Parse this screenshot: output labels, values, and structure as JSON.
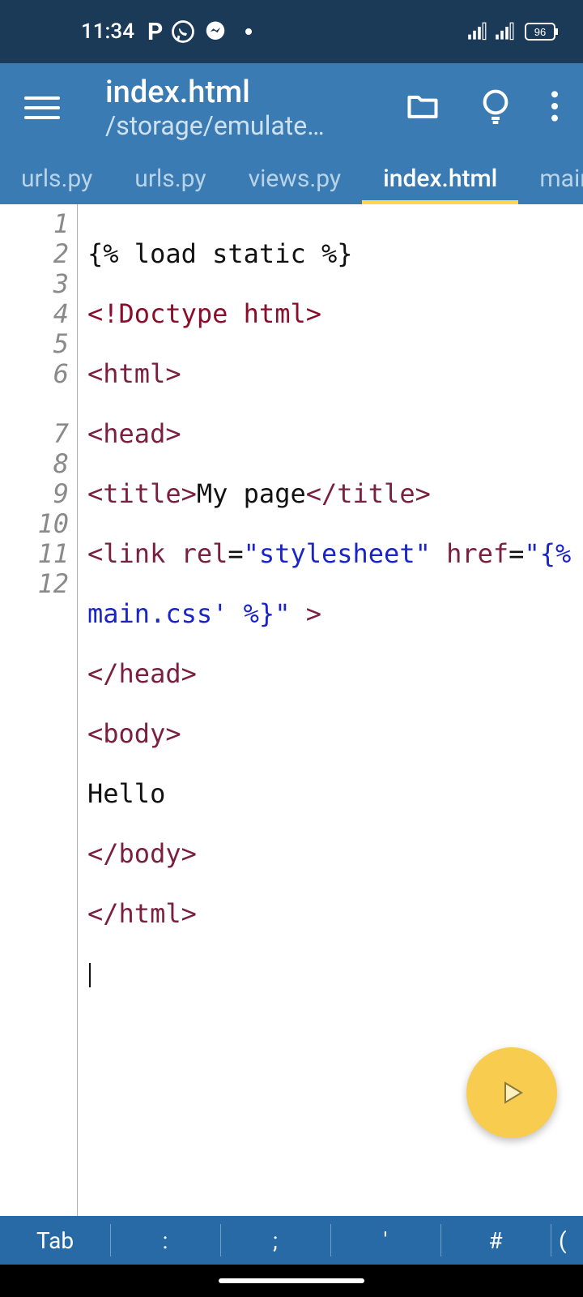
{
  "status": {
    "time": "11:34",
    "battery": "96"
  },
  "header": {
    "title": "index.html",
    "path": "/storage/emulate…"
  },
  "tabs": [
    {
      "label": "urls.py",
      "active": false
    },
    {
      "label": "urls.py",
      "active": false
    },
    {
      "label": "views.py",
      "active": false
    },
    {
      "label": "index.html",
      "active": true
    },
    {
      "label": "main.css",
      "active": false
    }
  ],
  "gutter": [
    "1",
    "2",
    "3",
    "4",
    "5",
    "6",
    "",
    "7",
    "8",
    "9",
    "10",
    "11",
    "12"
  ],
  "code": {
    "l1": "{% load static %}",
    "l2a": "<!Doctype html",
    "l3a": "<",
    "l3b": "html",
    "l3c": ">",
    "l4a": "<",
    "l4b": "head",
    "l4c": ">",
    "l5a": "<",
    "l5b": "title",
    "l5c": ">",
    "l5d": "My page",
    "l5e": "</",
    "l5f": "title",
    "l5g": ">",
    "l6a": "<",
    "l6b": "link",
    "l6sp": " ",
    "l6c": "rel",
    "l6d": "=",
    "l6e": "\"stylesheet\"",
    "l6sp2": " ",
    "l6f": "href",
    "l6g": "=",
    "l6h": "\"{% static 'todo/",
    "l6i": "main.css' %}\"",
    "l6j": " >",
    "l7a": "</",
    "l7b": "head",
    "l7c": ">",
    "l8a": "<",
    "l8b": "body",
    "l8c": ">",
    "l9": "Hello",
    "l10a": "</",
    "l10b": "body",
    "l10c": ">",
    "l11a": "</",
    "l11b": "html",
    "l11c": ">"
  },
  "toolbar": {
    "k0": "Tab",
    "k1": ":",
    "k2": ";",
    "k3": "'",
    "k4": "#",
    "k5": "("
  }
}
